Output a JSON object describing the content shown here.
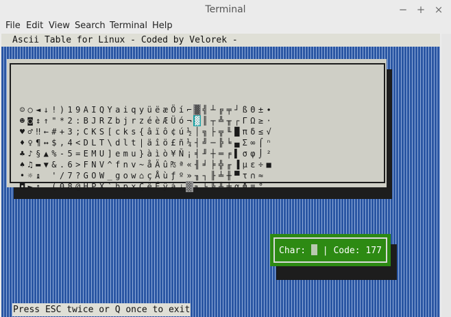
{
  "window": {
    "title": "Terminal",
    "controls": [
      "−",
      "+",
      "×"
    ]
  },
  "menubar": [
    "File",
    "Edit",
    "View",
    "Search",
    "Terminal",
    "Help"
  ],
  "app": {
    "header": "Ascii Table for Linux - Coded by Velorek -",
    "footer": "Press ESC twice or Q once to exit",
    "char_label": "Char:",
    "code_label": "| Code:",
    "code_value": "177"
  },
  "table": {
    "columns": [
      "☺☻♥♦♣♠•◘",
      "○◙♂♀♪♫☼►",
      "◄↕‼¶§▬↨↑",
      "↓↑←↔▲▼ ",
      "!\"#$%&'(",
      ")*+,-./0",
      "12345678",
      "9:;<=>?@",
      "ABCDEFGH",
      "IJKLMNOP",
      "QRSTUVWX",
      "YZ[\\]^_`",
      "abcdefgh",
      "ijklmnop",
      "qrstuvwx",
      "yz{|}~⌂Ç",
      "üéâäàåçê",
      "ëèïîìÄÅÉ",
      "æÆôöòûùÿ",
      "ÖÜ¢£¥₧ƒá",
      "íóúñÑªº¿",
      "⌐¬½¼¡«»░",
      "▒▓│┤╡╢╖╕",
      "╣║╗╝╜╛┐└",
      "┴┬├─┼╞╟╚",
      "╔╩╦╠═╬╧╨",
      "╤╥╙╘╒╓╫╪",
      "┘┌█▄▌▐▀α",
      "ßΓπΣσµτΦ",
      "ΘΩδ∞φε∩≡",
      "±≥≤⌠⌡÷≈°",
      "∙·√ⁿ²■  "
    ],
    "selected": {
      "column": 22,
      "row": 1
    }
  }
}
